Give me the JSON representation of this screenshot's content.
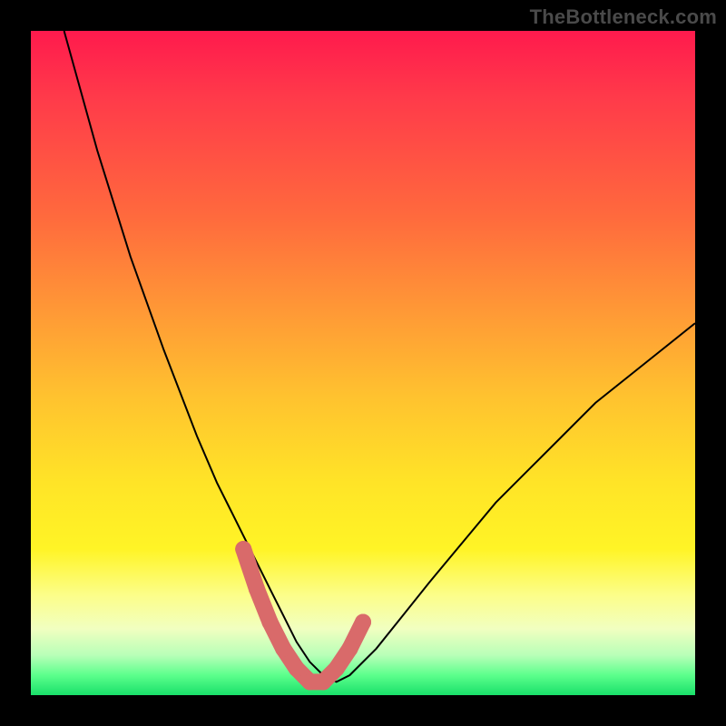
{
  "watermark": "TheBottleneck.com",
  "colors": {
    "frame": "#000000",
    "curve": "#000000",
    "marker": "#d96a6a",
    "gradient_stops": [
      "#ff1a4d",
      "#ff3a4a",
      "#ff6a3d",
      "#ff9836",
      "#ffc22f",
      "#ffe427",
      "#fff426",
      "#fcfe8a",
      "#f1ffc0",
      "#b8ffb8",
      "#5cff8c",
      "#19e06a"
    ]
  },
  "chart_data": {
    "type": "line",
    "title": "",
    "xlabel": "",
    "ylabel": "",
    "xlim": [
      0,
      100
    ],
    "ylim": [
      0,
      100
    ],
    "x": [
      5,
      10,
      15,
      20,
      25,
      28,
      30,
      32,
      34,
      36,
      38,
      40,
      42,
      44,
      46,
      48,
      52,
      56,
      60,
      65,
      70,
      75,
      80,
      85,
      90,
      95,
      100
    ],
    "values": [
      100,
      82,
      66,
      52,
      39,
      32,
      28,
      24,
      20,
      16,
      12,
      8,
      5,
      3,
      2,
      3,
      7,
      12,
      17,
      23,
      29,
      34,
      39,
      44,
      48,
      52,
      56
    ],
    "trough_markers_x": [
      32,
      34,
      36,
      38,
      40,
      42,
      44,
      46,
      48,
      50
    ],
    "trough_markers_y": [
      22,
      16,
      11,
      7,
      4,
      2,
      2,
      4,
      7,
      11
    ],
    "notes": "Asymmetric V-shaped curve; minimum near x≈44. No axis ticks or numeric labels are visible. Values estimated from pixel positions; y=0 at bottom, y=100 at top of gradient area."
  }
}
